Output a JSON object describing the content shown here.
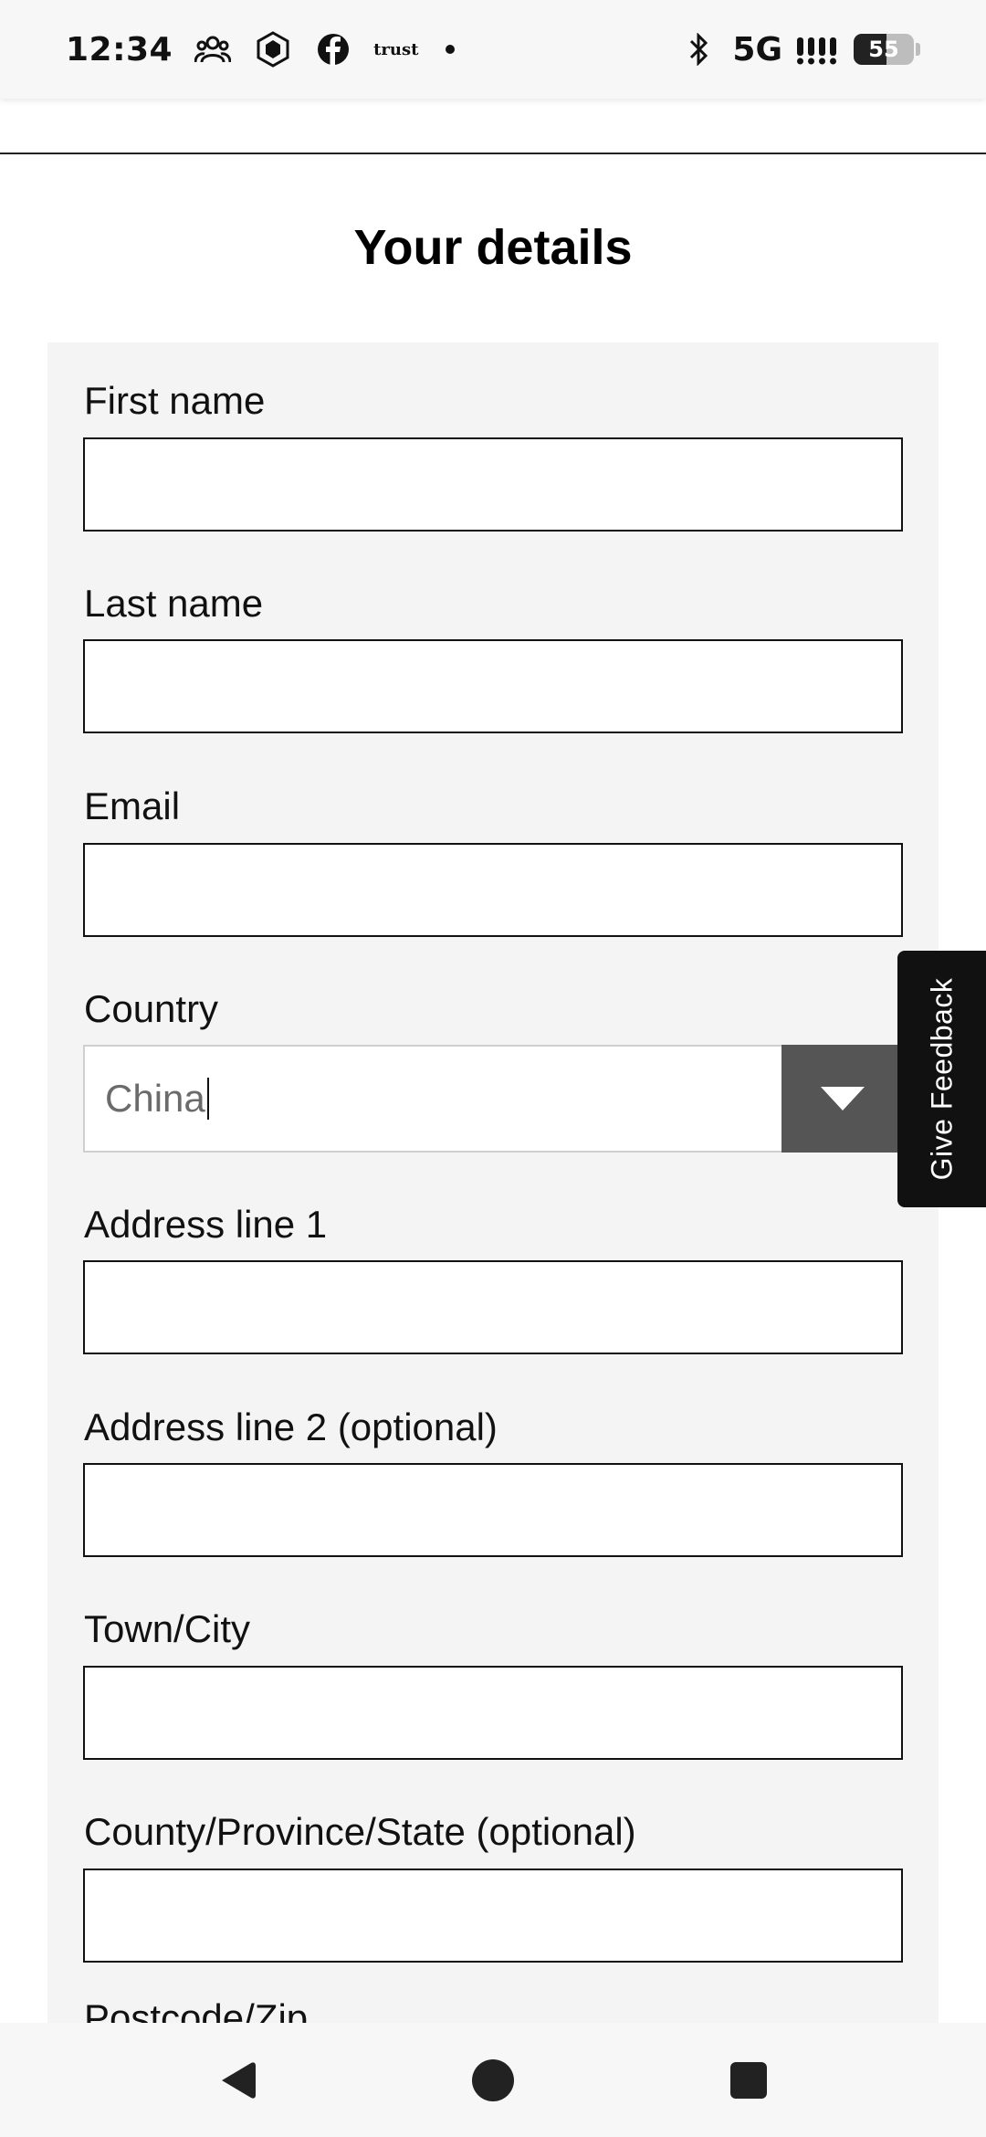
{
  "status_bar": {
    "time": "12:34",
    "icons": [
      "people-icon",
      "crypto-com-icon",
      "facebook-icon",
      "trust-app-icon",
      "notification-dot-icon"
    ],
    "trust_label": "trust",
    "bluetooth_icon": "bluetooth-icon",
    "network": "5G",
    "signal_icon": "signal-bars-icon",
    "battery_level": "55",
    "battery_percent": 55
  },
  "page": {
    "title": "Your details"
  },
  "form": {
    "fields": [
      {
        "label": "First name",
        "value": ""
      },
      {
        "label": "Last name",
        "value": ""
      },
      {
        "label": "Email",
        "value": ""
      },
      {
        "label": "Country",
        "value": "China"
      },
      {
        "label": "Address line 1",
        "value": ""
      },
      {
        "label": "Address line 2 (optional)",
        "value": ""
      },
      {
        "label": "Town/City",
        "value": ""
      },
      {
        "label": "County/Province/State (optional)",
        "value": ""
      }
    ],
    "partial_label": "Postcode/Zip"
  },
  "feedback": {
    "label": "Give Feedback"
  },
  "navigation": {
    "back": "back-icon",
    "home": "home-icon",
    "recents": "recents-icon"
  },
  "colors": {
    "card_bg": "#f4f4f4",
    "select_toggle_bg": "#555555",
    "feedback_bg": "#111111"
  }
}
